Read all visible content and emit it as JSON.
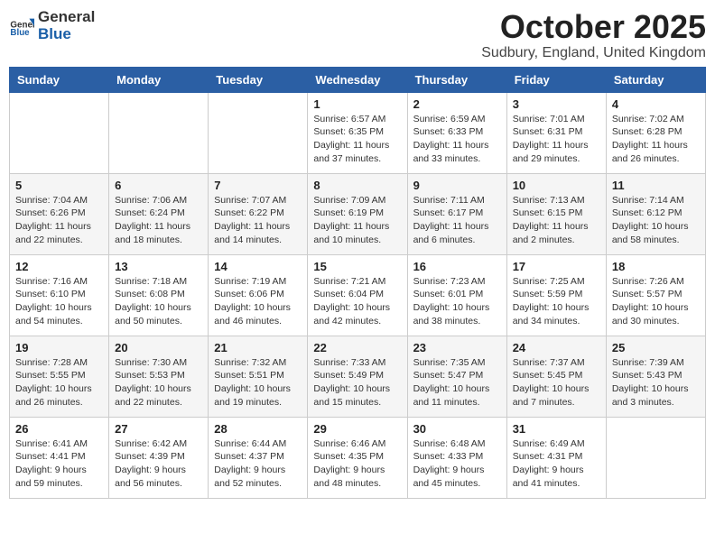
{
  "header": {
    "logo_general": "General",
    "logo_blue": "Blue",
    "month": "October 2025",
    "location": "Sudbury, England, United Kingdom"
  },
  "weekdays": [
    "Sunday",
    "Monday",
    "Tuesday",
    "Wednesday",
    "Thursday",
    "Friday",
    "Saturday"
  ],
  "weeks": [
    [
      {
        "day": "",
        "info": ""
      },
      {
        "day": "",
        "info": ""
      },
      {
        "day": "",
        "info": ""
      },
      {
        "day": "1",
        "info": "Sunrise: 6:57 AM\nSunset: 6:35 PM\nDaylight: 11 hours\nand 37 minutes."
      },
      {
        "day": "2",
        "info": "Sunrise: 6:59 AM\nSunset: 6:33 PM\nDaylight: 11 hours\nand 33 minutes."
      },
      {
        "day": "3",
        "info": "Sunrise: 7:01 AM\nSunset: 6:31 PM\nDaylight: 11 hours\nand 29 minutes."
      },
      {
        "day": "4",
        "info": "Sunrise: 7:02 AM\nSunset: 6:28 PM\nDaylight: 11 hours\nand 26 minutes."
      }
    ],
    [
      {
        "day": "5",
        "info": "Sunrise: 7:04 AM\nSunset: 6:26 PM\nDaylight: 11 hours\nand 22 minutes."
      },
      {
        "day": "6",
        "info": "Sunrise: 7:06 AM\nSunset: 6:24 PM\nDaylight: 11 hours\nand 18 minutes."
      },
      {
        "day": "7",
        "info": "Sunrise: 7:07 AM\nSunset: 6:22 PM\nDaylight: 11 hours\nand 14 minutes."
      },
      {
        "day": "8",
        "info": "Sunrise: 7:09 AM\nSunset: 6:19 PM\nDaylight: 11 hours\nand 10 minutes."
      },
      {
        "day": "9",
        "info": "Sunrise: 7:11 AM\nSunset: 6:17 PM\nDaylight: 11 hours\nand 6 minutes."
      },
      {
        "day": "10",
        "info": "Sunrise: 7:13 AM\nSunset: 6:15 PM\nDaylight: 11 hours\nand 2 minutes."
      },
      {
        "day": "11",
        "info": "Sunrise: 7:14 AM\nSunset: 6:12 PM\nDaylight: 10 hours\nand 58 minutes."
      }
    ],
    [
      {
        "day": "12",
        "info": "Sunrise: 7:16 AM\nSunset: 6:10 PM\nDaylight: 10 hours\nand 54 minutes."
      },
      {
        "day": "13",
        "info": "Sunrise: 7:18 AM\nSunset: 6:08 PM\nDaylight: 10 hours\nand 50 minutes."
      },
      {
        "day": "14",
        "info": "Sunrise: 7:19 AM\nSunset: 6:06 PM\nDaylight: 10 hours\nand 46 minutes."
      },
      {
        "day": "15",
        "info": "Sunrise: 7:21 AM\nSunset: 6:04 PM\nDaylight: 10 hours\nand 42 minutes."
      },
      {
        "day": "16",
        "info": "Sunrise: 7:23 AM\nSunset: 6:01 PM\nDaylight: 10 hours\nand 38 minutes."
      },
      {
        "day": "17",
        "info": "Sunrise: 7:25 AM\nSunset: 5:59 PM\nDaylight: 10 hours\nand 34 minutes."
      },
      {
        "day": "18",
        "info": "Sunrise: 7:26 AM\nSunset: 5:57 PM\nDaylight: 10 hours\nand 30 minutes."
      }
    ],
    [
      {
        "day": "19",
        "info": "Sunrise: 7:28 AM\nSunset: 5:55 PM\nDaylight: 10 hours\nand 26 minutes."
      },
      {
        "day": "20",
        "info": "Sunrise: 7:30 AM\nSunset: 5:53 PM\nDaylight: 10 hours\nand 22 minutes."
      },
      {
        "day": "21",
        "info": "Sunrise: 7:32 AM\nSunset: 5:51 PM\nDaylight: 10 hours\nand 19 minutes."
      },
      {
        "day": "22",
        "info": "Sunrise: 7:33 AM\nSunset: 5:49 PM\nDaylight: 10 hours\nand 15 minutes."
      },
      {
        "day": "23",
        "info": "Sunrise: 7:35 AM\nSunset: 5:47 PM\nDaylight: 10 hours\nand 11 minutes."
      },
      {
        "day": "24",
        "info": "Sunrise: 7:37 AM\nSunset: 5:45 PM\nDaylight: 10 hours\nand 7 minutes."
      },
      {
        "day": "25",
        "info": "Sunrise: 7:39 AM\nSunset: 5:43 PM\nDaylight: 10 hours\nand 3 minutes."
      }
    ],
    [
      {
        "day": "26",
        "info": "Sunrise: 6:41 AM\nSunset: 4:41 PM\nDaylight: 9 hours\nand 59 minutes."
      },
      {
        "day": "27",
        "info": "Sunrise: 6:42 AM\nSunset: 4:39 PM\nDaylight: 9 hours\nand 56 minutes."
      },
      {
        "day": "28",
        "info": "Sunrise: 6:44 AM\nSunset: 4:37 PM\nDaylight: 9 hours\nand 52 minutes."
      },
      {
        "day": "29",
        "info": "Sunrise: 6:46 AM\nSunset: 4:35 PM\nDaylight: 9 hours\nand 48 minutes."
      },
      {
        "day": "30",
        "info": "Sunrise: 6:48 AM\nSunset: 4:33 PM\nDaylight: 9 hours\nand 45 minutes."
      },
      {
        "day": "31",
        "info": "Sunrise: 6:49 AM\nSunset: 4:31 PM\nDaylight: 9 hours\nand 41 minutes."
      },
      {
        "day": "",
        "info": ""
      }
    ]
  ]
}
